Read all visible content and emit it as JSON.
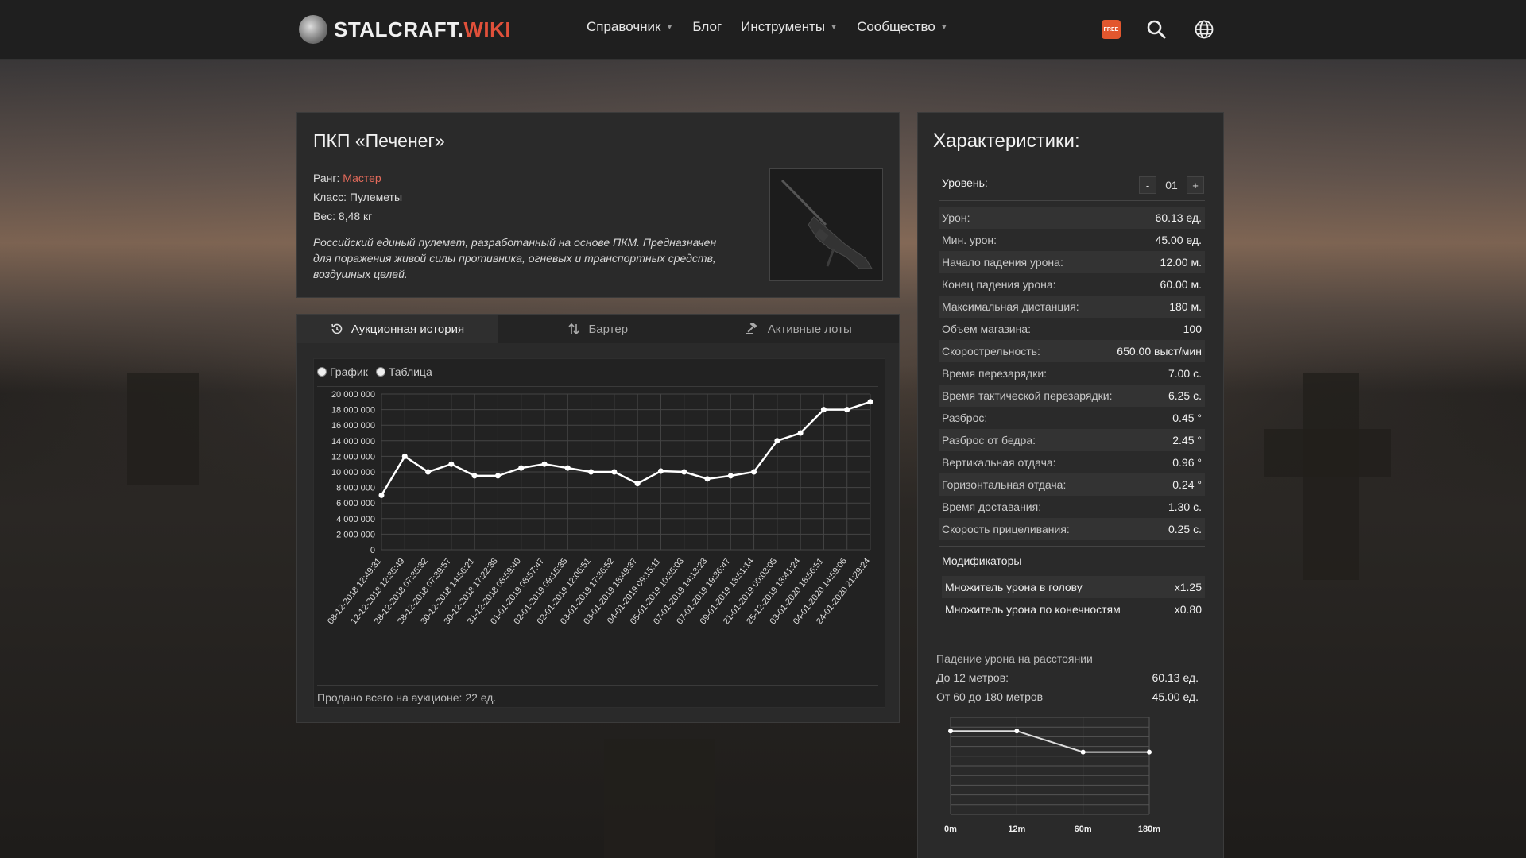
{
  "header": {
    "logo_word1": "STALCRAFT.",
    "logo_word2": "WIKI",
    "nav": [
      {
        "label": "Справочник",
        "has_dropdown": true
      },
      {
        "label": "Блог",
        "has_dropdown": false
      },
      {
        "label": "Инструменты",
        "has_dropdown": true
      },
      {
        "label": "Сообщество",
        "has_dropdown": true
      }
    ],
    "free_badge": "FREE",
    "icons": [
      "search-icon",
      "globe-icon"
    ]
  },
  "item": {
    "title": "ПКП «Печенег»",
    "rank_label": "Ранг:",
    "rank_value": "Мастер",
    "class_line": "Класс: Пулеметы",
    "weight_line": "Вес: 8,48 кг",
    "description": "Российский единый пулемет, разработанный на основе ПКМ. Предназначен для поражения живой силы противника, огневых и транспортных средств, воздушных целей."
  },
  "history": {
    "tabs": [
      {
        "label": "Аукционная история",
        "icon": "history-icon",
        "active": true
      },
      {
        "label": "Бартер",
        "icon": "swap-icon",
        "active": false
      },
      {
        "label": "Активные лоты",
        "icon": "gavel-icon",
        "active": false
      }
    ],
    "view_options": [
      "График",
      "Таблица"
    ],
    "sold_total": "Продано всего на аукционе: 22 ед."
  },
  "chart_data": [
    {
      "type": "line",
      "title": "",
      "xlabel": "",
      "ylabel": "",
      "ylim": [
        0,
        20000000
      ],
      "y_ticks": [
        "20 000 000",
        "18 000 000",
        "16 000 000",
        "14 000 000",
        "12 000 000",
        "10 000 000",
        "8 000 000",
        "6 000 000",
        "4 000 000",
        "2 000 000",
        "0"
      ],
      "x": [
        "08-12-2018 12:49:31",
        "12-12-2018 12:35:49",
        "28-12-2018 07:35:32",
        "28-12-2018 07:39:57",
        "30-12-2018 14:56:21",
        "30-12-2018 17:22:38",
        "31-12-2018 08:59:40",
        "01-01-2019 08:57:47",
        "02-01-2019 09:15:35",
        "02-01-2019 12:06:51",
        "03-01-2019 17:36:52",
        "03-01-2019 18:49:37",
        "04-01-2019 09:15:11",
        "05-01-2019 10:35:03",
        "07-01-2019 14:13:23",
        "07-01-2019 19:36:47",
        "09-01-2019 13:51:14",
        "21-01-2019 00:03:05",
        "25-12-2019 13:41:24",
        "03-01-2020 18:56:51",
        "04-01-2020 14:59:06",
        "24-01-2020 21:29:24"
      ],
      "series": [
        {
          "values": [
            7000000,
            12000000,
            10000000,
            11000000,
            9500000,
            9500000,
            10500000,
            11000000,
            10500000,
            10000000,
            10000000,
            8500000,
            10100000,
            10000000,
            9100000,
            9500000,
            10000000,
            14000000,
            15000000,
            18000000,
            18000000,
            19000000
          ]
        }
      ],
      "grid": true,
      "point_color": "#ffffff",
      "line_color": "#ffffff"
    },
    {
      "type": "line",
      "title": "",
      "xlabel": "",
      "ylabel": "",
      "x": [
        "0m",
        "12m",
        "60m",
        "180m"
      ],
      "series": [
        {
          "values": [
            60.13,
            60.13,
            45.0,
            45.0
          ]
        }
      ],
      "grid": true
    }
  ],
  "stats": {
    "title": "Характеристики:",
    "level_label": "Уровень:",
    "level_value": "01",
    "minus": "-",
    "plus": "+",
    "rows": [
      {
        "label": "Урон:",
        "value": "60.13 ед."
      },
      {
        "label": "Мин. урон:",
        "value": "45.00 ед."
      },
      {
        "label": "Начало падения урона:",
        "value": "12.00 м."
      },
      {
        "label": "Конец падения урона:",
        "value": "60.00 м."
      },
      {
        "label": "Максимальная дистанция:",
        "value": "180 м."
      },
      {
        "label": "Объем магазина:",
        "value": "100"
      },
      {
        "label": "Скорострельность:",
        "value": "650.00 выст/мин"
      },
      {
        "label": "Время перезарядки:",
        "value": "7.00 с."
      },
      {
        "label": "Время тактической перезарядки:",
        "value": "6.25 с."
      },
      {
        "label": "Разброс:",
        "value": "0.45 °"
      },
      {
        "label": "Разброс от бедра:",
        "value": "2.45 °"
      },
      {
        "label": "Вертикальная отдача:",
        "value": "0.96 °"
      },
      {
        "label": "Горизонтальная отдача:",
        "value": "0.24 °"
      },
      {
        "label": "Время доставания:",
        "value": "1.30 с."
      },
      {
        "label": "Скорость прицеливания:",
        "value": "0.25 с."
      }
    ],
    "modifiers_title": "Модификаторы",
    "modifiers": [
      {
        "label": "Множитель урона в голову",
        "value": "x1.25"
      },
      {
        "label": "Множитель урона по конечностям",
        "value": "x0.80"
      }
    ],
    "falloff": {
      "title": "Падение урона на расстоянии",
      "rows": [
        {
          "label": "До 12 метров:",
          "value": "60.13 ед."
        },
        {
          "label": "От 60 до 180 метров",
          "value": "45.00 ед."
        }
      ]
    }
  }
}
